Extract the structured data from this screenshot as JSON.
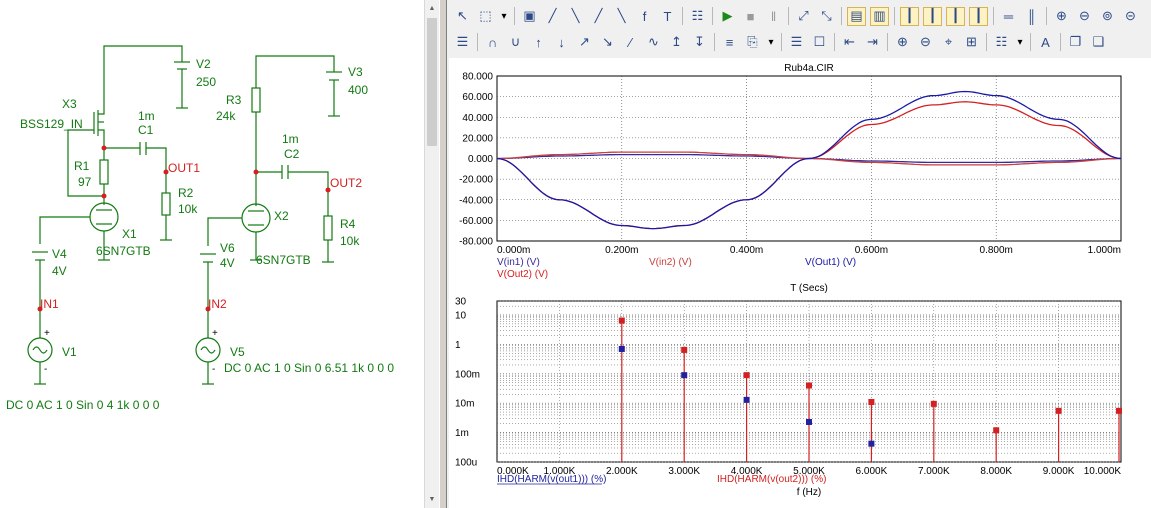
{
  "schematic": {
    "components": [
      {
        "ref": "X3",
        "value": "BSS129_IN"
      },
      {
        "ref": "C1",
        "value": "1m"
      },
      {
        "ref": "R1",
        "value": "97"
      },
      {
        "ref": "R2",
        "value": "10k"
      },
      {
        "ref": "X1",
        "value": "6SN7GTB"
      },
      {
        "ref": "V2",
        "value": "250"
      },
      {
        "ref": "V3",
        "value": "400"
      },
      {
        "ref": "R3",
        "value": "24k"
      },
      {
        "ref": "C2",
        "value": "1m"
      },
      {
        "ref": "R4",
        "value": "10k"
      },
      {
        "ref": "X2",
        "value": "6SN7GTB"
      },
      {
        "ref": "V4",
        "value": "4V"
      },
      {
        "ref": "V6",
        "value": "4V"
      },
      {
        "ref": "V1",
        "value": "DC 0 AC 1 0 Sin 0 4 1k 0 0 0"
      },
      {
        "ref": "V5",
        "value": "DC 0 AC 1 0 Sin 0 6.51 1k 0 0 0"
      }
    ],
    "nodes": [
      "OUT1",
      "OUT2",
      "IN1",
      "IN2"
    ],
    "polarity": [
      "+",
      "-"
    ]
  },
  "toolbar": {
    "row1": [
      "select-arrow",
      "zoom-pointer",
      "dropdown",
      "window-box",
      "scope-a",
      "scope-b",
      "scope-c",
      "scope-d",
      "function-fx",
      "text-tool",
      "property-sheet",
      "run",
      "stop",
      "pause",
      "cursor-a",
      "cursor-b",
      "tile-a",
      "tile-b",
      "layout-1",
      "layout-2",
      "layout-3",
      "layout-4",
      "split-h",
      "split-v",
      "zoom-in",
      "zoom-out",
      "zoom-fit",
      "zoom-reset"
    ],
    "row2": [
      "properties",
      "peak",
      "valley",
      "high",
      "low",
      "rise",
      "fall",
      "slope",
      "inflection",
      "global-high",
      "global-low",
      "data-point",
      "paste",
      "dropdown",
      "page",
      "tag",
      "step-a",
      "step-b",
      "zoom-in",
      "zoom-out",
      "zoom-area",
      "zoom-full",
      "grid",
      "dropdown",
      "font-a",
      "copy",
      "paste-b"
    ]
  },
  "chart_data": [
    {
      "type": "line",
      "title": "Rub4a.CIR",
      "xlabel": "T (Secs)",
      "xlim": [
        0,
        1.0
      ],
      "ylim": [
        -80,
        80
      ],
      "x_ticks": [
        "0.000m",
        "0.200m",
        "0.400m",
        "0.600m",
        "0.800m",
        "1.000m"
      ],
      "y_ticks": [
        "80.000",
        "60.000",
        "40.000",
        "20.000",
        "0.000",
        "-20.000",
        "-40.000",
        "-60.000",
        "-80.000"
      ],
      "grid": true,
      "legend_placement": "bottom-left",
      "series": [
        {
          "name": "V(in1) (V)",
          "color": "#3a2a9a",
          "x": [
            0,
            0.1,
            0.2,
            0.3,
            0.4,
            0.5,
            0.6,
            0.7,
            0.8,
            0.9,
            1.0
          ],
          "values": [
            0,
            2.4,
            3.8,
            3.8,
            2.4,
            0,
            -2.4,
            -3.8,
            -3.8,
            -2.4,
            0
          ]
        },
        {
          "name": "V(Out2) (V)",
          "color": "#d42020",
          "x": [
            0,
            0.1,
            0.2,
            0.25,
            0.3,
            0.4,
            0.5,
            0.6,
            0.7,
            0.75,
            0.8,
            0.9,
            1.0
          ],
          "values": [
            0,
            -40,
            -65,
            -68,
            -65,
            -40,
            0,
            33,
            52,
            55,
            52,
            32,
            0
          ]
        },
        {
          "name": "V(in2) (V)",
          "color": "#c84040",
          "x": [
            0,
            0.1,
            0.2,
            0.3,
            0.4,
            0.5,
            0.6,
            0.7,
            0.8,
            0.9,
            1.0
          ],
          "values": [
            0,
            3.8,
            6.2,
            6.2,
            3.8,
            0,
            -3.8,
            -6.2,
            -6.2,
            -3.8,
            0
          ]
        },
        {
          "name": "V(Out1) (V)",
          "color": "#1a1aa8",
          "x": [
            0,
            0.1,
            0.2,
            0.25,
            0.3,
            0.4,
            0.5,
            0.6,
            0.7,
            0.75,
            0.8,
            0.9,
            1.0
          ],
          "values": [
            0,
            -40,
            -65,
            -68,
            -65,
            -40,
            0,
            38,
            61,
            65,
            61,
            38,
            0
          ]
        }
      ]
    },
    {
      "type": "scatter",
      "xlabel": "f (Hz)",
      "xlim": [
        0,
        10000
      ],
      "y_scale": "log",
      "ylim": [
        0.0001,
        30
      ],
      "x_ticks": [
        "0.000K",
        "1.000K",
        "2.000K",
        "3.000K",
        "4.000K",
        "5.000K",
        "6.000K",
        "7.000K",
        "8.000K",
        "9.000K",
        "10.000K"
      ],
      "y_ticks": [
        "30",
        "10",
        "1",
        "100m",
        "10m",
        "1m",
        "100u"
      ],
      "grid": true,
      "series": [
        {
          "name": "IHD(HARM(v(out1))) (%)",
          "color": "#2222a0",
          "x": [
            2000,
            3000,
            4000,
            5000,
            6000
          ],
          "values": [
            0.7,
            0.09,
            0.013,
            0.0023,
            0.00042
          ]
        },
        {
          "name": "IHD(HARM(v(out2))) (%)",
          "color": "#d42020",
          "x": [
            2000,
            3000,
            4000,
            5000,
            6000,
            7000,
            8000,
            9000,
            10000
          ],
          "values": [
            6.5,
            0.65,
            0.09,
            0.04,
            0.011,
            0.0095,
            0.0012,
            0.0055,
            0.0055
          ]
        }
      ]
    }
  ]
}
